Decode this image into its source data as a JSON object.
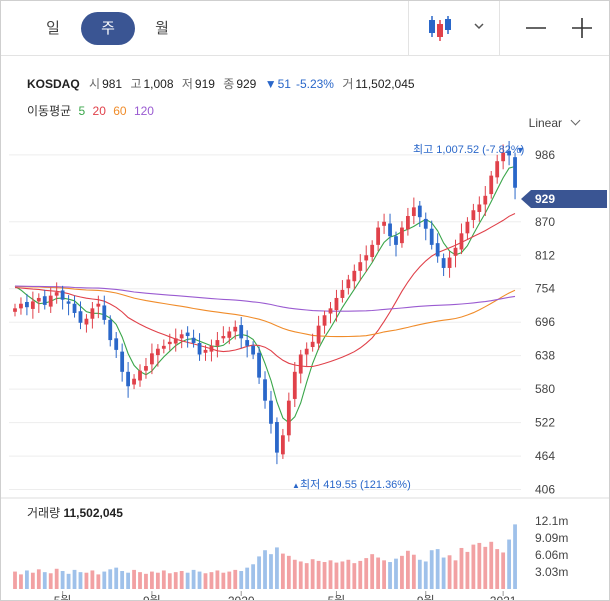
{
  "tabs": [
    {
      "label": "일",
      "active": false
    },
    {
      "label": "주",
      "active": true
    },
    {
      "label": "월",
      "active": false
    }
  ],
  "toolbar": {
    "chart_type_icon": "candlestick-icon",
    "zoom_out_icon": "minus-icon",
    "zoom_in_icon": "plus-icon"
  },
  "quote": {
    "symbol": "KOSDAQ",
    "open_label": "시",
    "open": "981",
    "high_label": "고",
    "high": "1,008",
    "low_label": "저",
    "low": "919",
    "close_label": "종",
    "close": "929",
    "change_arrow": "▼",
    "change": "51",
    "change_pct": "-5.23%",
    "volume_label": "거",
    "volume": "11,502,045"
  },
  "moving_average": {
    "label": "이동평균",
    "periods": [
      {
        "label": "5",
        "color": "#3aa64a"
      },
      {
        "label": "20",
        "color": "#e0414a"
      },
      {
        "label": "60",
        "color": "#f08c2a"
      },
      {
        "label": "120",
        "color": "#9a5bd1"
      }
    ]
  },
  "scale_mode": "Linear",
  "price_axis": {
    "ticks": [
      "986",
      "870",
      "812",
      "754",
      "696",
      "638",
      "580",
      "522",
      "464",
      "406"
    ],
    "current_price": "929"
  },
  "annotations": {
    "max": "최고 1,007.52 (-7.82%)",
    "max_arrow": "▼",
    "min": "최저 419.55 (121.36%)",
    "min_arrow": "▲"
  },
  "volume_panel": {
    "label": "거래량",
    "value": "11,502,045",
    "ticks": [
      "12.1m",
      "9.09m",
      "6.06m",
      "3.03m"
    ]
  },
  "time_axis": {
    "labels": [
      "5월",
      "9월",
      "2020",
      "5월",
      "9월",
      "2021"
    ]
  },
  "colors": {
    "up": "#e0414a",
    "down": "#2a67c9",
    "accent": "#3a5593",
    "vol_up": "#f2a1a3",
    "vol_down": "#9fc1ea"
  },
  "chart_data": {
    "type": "candlestick",
    "y_range": [
      406,
      1008
    ],
    "volume_range": [
      0,
      12.1
    ],
    "current": 929,
    "max": 1007.52,
    "min": 419.55,
    "closes": [
      720,
      728,
      722,
      732,
      738,
      726,
      742,
      748,
      735,
      728,
      712,
      695,
      702,
      720,
      728,
      700,
      665,
      648,
      610,
      585,
      598,
      612,
      620,
      642,
      650,
      655,
      662,
      668,
      675,
      672,
      660,
      640,
      648,
      655,
      665,
      672,
      680,
      688,
      668,
      655,
      640,
      600,
      560,
      520,
      470,
      500,
      560,
      610,
      640,
      650,
      662,
      690,
      708,
      720,
      738,
      752,
      770,
      785,
      800,
      812,
      830,
      860,
      870,
      845,
      830,
      860,
      880,
      895,
      878,
      858,
      830,
      810,
      790,
      808,
      825,
      850,
      870,
      890,
      900,
      915,
      950,
      975,
      990,
      985,
      929
    ],
    "volumes": [
      3.1,
      2.6,
      3.3,
      2.9,
      3.5,
      3.0,
      2.8,
      3.6,
      3.2,
      2.7,
      3.4,
      3.0,
      2.9,
      3.3,
      2.6,
      3.1,
      3.5,
      3.8,
      3.2,
      2.9,
      3.4,
      3.0,
      2.7,
      3.1,
      2.9,
      3.3,
      2.8,
      3.0,
      3.2,
      2.9,
      3.4,
      3.1,
      2.8,
      3.0,
      3.3,
      2.9,
      3.1,
      3.4,
      3.2,
      3.8,
      4.4,
      5.8,
      6.9,
      6.2,
      7.4,
      6.3,
      5.9,
      5.2,
      4.9,
      4.6,
      5.3,
      5.0,
      4.8,
      5.1,
      4.7,
      4.9,
      5.2,
      4.6,
      5.0,
      5.5,
      6.2,
      5.6,
      5.1,
      4.8,
      5.4,
      5.9,
      6.8,
      6.1,
      5.2,
      4.9,
      6.9,
      7.1,
      5.6,
      6.0,
      5.1,
      7.3,
      6.6,
      7.9,
      8.2,
      7.5,
      8.4,
      7.1,
      6.5,
      8.8,
      11.5
    ]
  }
}
